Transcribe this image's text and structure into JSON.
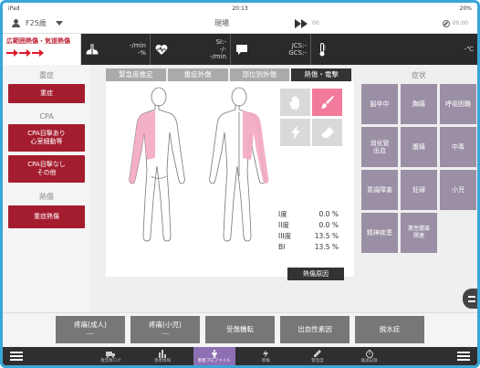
{
  "status": {
    "left": "iPad",
    "time": "20:13",
    "right": "20%"
  },
  "header": {
    "patient_label": "F25歳",
    "scene_label": "現場",
    "ffw_label": "00",
    "ffw_sub": "",
    "right_label": "00:00"
  },
  "vitals": {
    "alert_title": "広範囲熱傷・気道熱傷",
    "alert_arrows": "➤➤➤",
    "resp": "-/min\n-%",
    "heart": "SI:-\n-/-\n-/min",
    "consciousness": "JCS:-\nGCS:-",
    "temp": "-℃"
  },
  "left": {
    "severity_title": "重症",
    "severity_btn": "重症",
    "cpa_title": "CPA",
    "cpa_btn1": "CPA目撃あり\n心室細動等",
    "cpa_btn2": "CPA目撃なし\nその他",
    "burn_title": "熱傷",
    "burn_btn": "重症熱傷"
  },
  "tabs": [
    "緊急度推定",
    "重症外傷",
    "部位別外傷",
    "熱傷・電撃"
  ],
  "burn": {
    "deg1_label": "I度",
    "deg1_val": "0.0",
    "deg2_label": "II度",
    "deg2_val": "0.0",
    "deg3_label": "III度",
    "deg3_val": "13.5",
    "bi_label": "BI",
    "bi_val": "13.5",
    "unit": "%",
    "cause_btn": "熱傷原因"
  },
  "symptoms": {
    "title": "症状",
    "items": [
      "脳卒中",
      "胸痛",
      "呼吸困難",
      "消化管\n出血",
      "腹痛",
      "中毒",
      "意識障害",
      "妊婦",
      "小児",
      "精神疾患",
      "悪性腫瘍\n関連",
      ""
    ]
  },
  "bottom": {
    "b1": "疼痛(成人)",
    "b1_sub": "----",
    "b2": "疼痛(小児)",
    "b2_sub": "----",
    "b3": "受傷機転",
    "b4": "出血性素因",
    "b5": "脱水症"
  },
  "nav": {
    "items": [
      "救急隊ログ",
      "患者情報",
      "患者プロファイル",
      "熱傷",
      "緊急度",
      "搬送記録"
    ]
  },
  "colors": {
    "accent_red": "#a41d2f",
    "burn_pink": "#f2a7c0",
    "symptom_purple": "#9a8fa5",
    "nav_active": "#8d6fb4"
  }
}
